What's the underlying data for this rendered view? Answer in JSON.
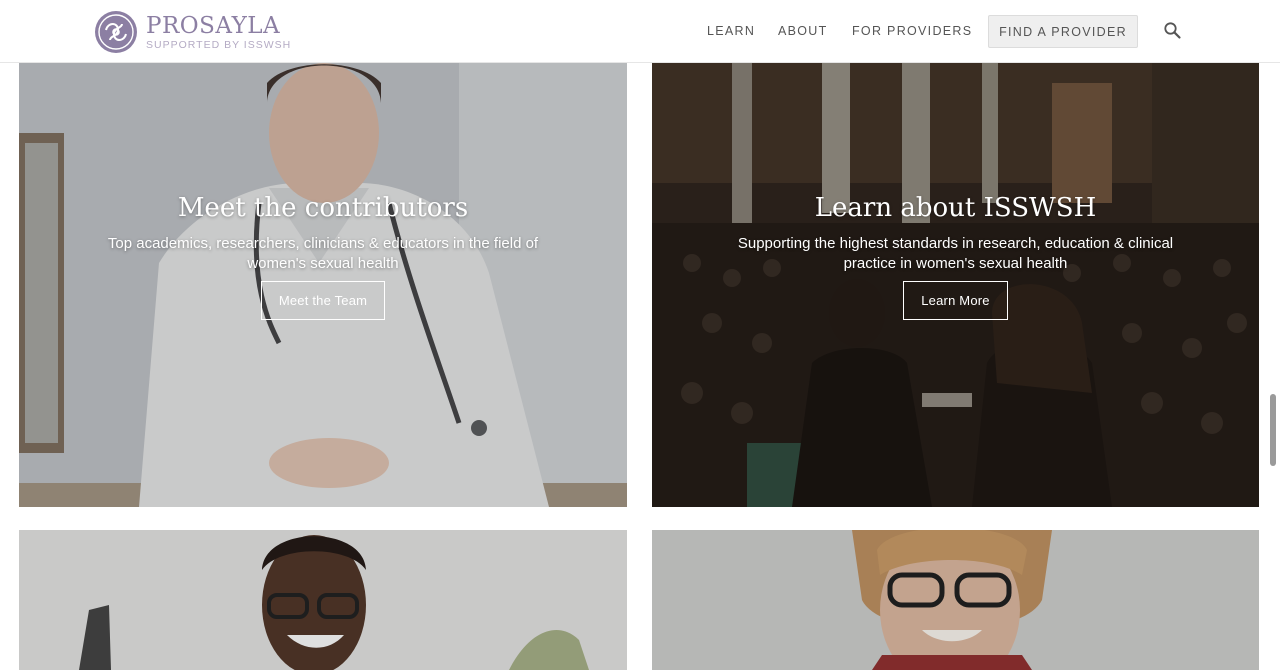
{
  "header": {
    "logo_name": "PROSAYLA",
    "logo_sub": "SUPPORTED BY ISSWSH",
    "nav": {
      "learn": "LEARN",
      "about": "ABOUT",
      "providers": "FOR PROVIDERS",
      "find_provider": "FIND A PROVIDER"
    },
    "search_icon": "search-icon"
  },
  "cards": [
    {
      "title": "Meet the contributors",
      "description": "Top academics, researchers, clinicians & educators in the field of women's sexual health",
      "button": "Meet the Team"
    },
    {
      "title": "Learn about ISSWSH",
      "description": "Supporting the highest standards in research, education & clinical practice in women's sexual health",
      "button": "Learn More"
    }
  ],
  "colors": {
    "brand": "#8c7fa3",
    "nav_text": "#555555",
    "button_bg": "#efefef"
  }
}
